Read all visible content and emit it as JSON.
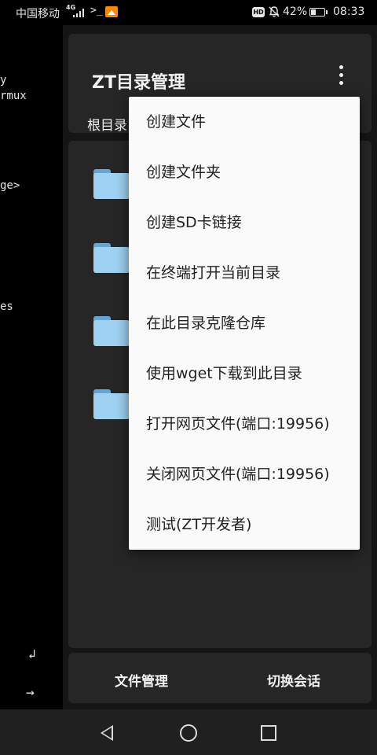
{
  "status_bar": {
    "carrier": "中国移动",
    "network": "4G",
    "terminal_icon": "terminal-icon",
    "hd": "HD",
    "battery_percent": "42%",
    "battery_level": 0.42,
    "time": "08:33"
  },
  "terminal": {
    "lines": [
      "y",
      "rmux",
      "ge>",
      "es"
    ],
    "enter_key": "↲",
    "arrow_key": "→"
  },
  "app": {
    "title": "ZT目录管理",
    "breadcrumb": "根目录"
  },
  "menu": {
    "items": [
      "创建文件",
      "创建文件夹",
      "创建SD卡链接",
      "在终端打开当前目录",
      "在此目录克隆仓库",
      "使用wget下载到此目录",
      "打开网页文件(端口:19956)",
      "关闭网页文件(端口:19956)",
      "测试(ZT开发者)"
    ]
  },
  "bottom_bar": {
    "file_manager": "文件管理",
    "switch_session": "切换会话"
  },
  "colors": {
    "background": "#151515",
    "card": "#262626",
    "menu_bg": "#fafafa",
    "folder": "#9fd1f2"
  }
}
